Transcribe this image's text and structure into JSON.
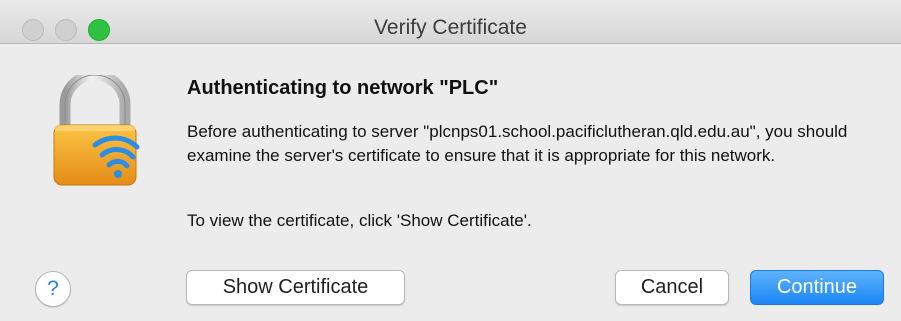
{
  "window": {
    "title": "Verify Certificate",
    "traffic_lights": [
      "close",
      "minimize",
      "zoom"
    ]
  },
  "dialog": {
    "icon": "lock-wifi-icon",
    "heading": "Authenticating to network \"PLC\"",
    "message": "Before authenticating to server \"plcnps01.school.pacificlutheran.qld.edu.au\", you should examine the server's certificate to ensure that it is appropriate for this network.",
    "instruction": "To view the certificate, click 'Show Certificate'."
  },
  "buttons": {
    "help": "?",
    "show_certificate": "Show Certificate",
    "cancel": "Cancel",
    "continue": "Continue"
  },
  "colors": {
    "accent": "#1b86f6",
    "lock_body": "#f2a72a",
    "zoom": "#2fc140"
  }
}
